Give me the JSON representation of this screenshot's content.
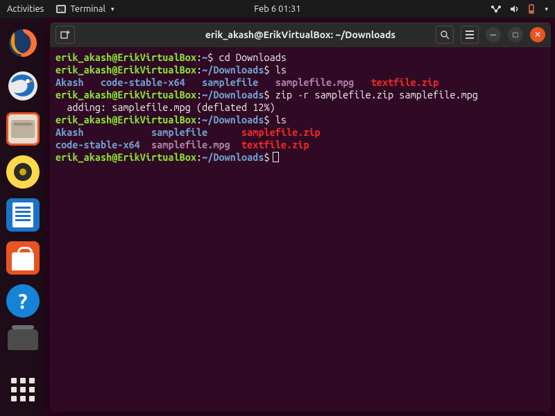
{
  "panel": {
    "activities": "Activities",
    "app_label": "Terminal",
    "clock": "Feb 6  01:31"
  },
  "titlebar": {
    "title": "erik_akash@ErikVirtualBox: ~/Downloads"
  },
  "prompt": {
    "user_host": "erik_akash@ErikVirtualBox",
    "home_path": "~",
    "dl_path": "~/Downloads",
    "sep": ":",
    "sigil": "$"
  },
  "cmds": {
    "cd": "cd Downloads",
    "ls": "ls",
    "zip": "zip -r samplefile.zip samplefile.mpg",
    "zip_out": "  adding: samplefile.mpg (deflated 12%)"
  },
  "ls1": {
    "c0": "Akash",
    "c1": "code-stable-x64",
    "c2": "samplefile",
    "c3": "samplefile.mpg",
    "c4": "textfile.zip"
  },
  "ls2": {
    "r0c0": "Akash",
    "r0c1": "samplefile",
    "r0c2": "samplefile.zip",
    "r1c0": "code-stable-x64",
    "r1c1": "samplefile.mpg",
    "r1c2": "textfile.zip"
  }
}
